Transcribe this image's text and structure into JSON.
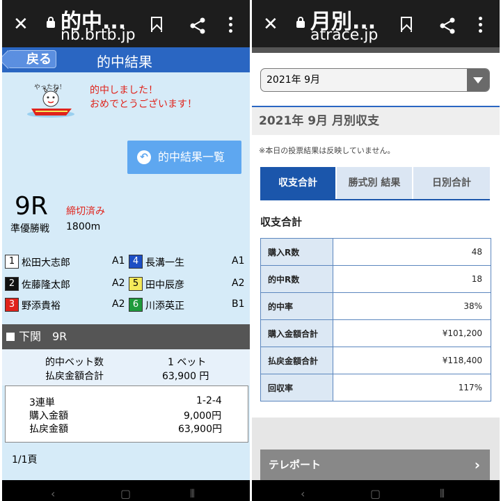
{
  "left": {
    "browser": {
      "title": "的中...",
      "url": "nb.brtb.jp"
    },
    "header": {
      "back_label": "戻る",
      "title": "的中結果"
    },
    "mascot_caption": "やったね！",
    "message": {
      "line1": "的中しました！",
      "line2": "おめでとうございます！"
    },
    "results_list_button": "的中結果一覧",
    "race": {
      "number": "9R",
      "status": "締切済み",
      "type": "準優勝戦",
      "distance": "1800m"
    },
    "racers": [
      {
        "num": "1",
        "name": "松田大志郎",
        "cls": "A1",
        "bg": "#ffffff",
        "fg": "#000000"
      },
      {
        "num": "2",
        "name": "佐藤隆太郎",
        "cls": "A2",
        "bg": "#111111",
        "fg": "#ffffff"
      },
      {
        "num": "3",
        "name": "野添貴裕",
        "cls": "A2",
        "bg": "#e0231b",
        "fg": "#ffffff"
      },
      {
        "num": "4",
        "name": "長溝一生",
        "cls": "A1",
        "bg": "#1d4fc4",
        "fg": "#ffffff"
      },
      {
        "num": "5",
        "name": "田中辰彦",
        "cls": "A2",
        "bg": "#f4ea5a",
        "fg": "#000000"
      },
      {
        "num": "6",
        "name": "川添英正",
        "cls": "B1",
        "bg": "#1f9a3c",
        "fg": "#ffffff"
      }
    ],
    "venue": {
      "name": "下関",
      "race": "9R"
    },
    "summary": {
      "bets_label": "的中ベット数",
      "bets_value": "1 ベット",
      "payout_label": "払戻金額合計",
      "payout_value": "63,900 円"
    },
    "detail": {
      "bet_type": "3連単",
      "combination": "1-2-4",
      "purchase_label": "購入金額",
      "purchase_value": "9,000円",
      "payout_label": "払戻金額",
      "payout_value": "63,900円"
    },
    "pages": "1/1頁"
  },
  "right": {
    "browser": {
      "title": "月別...",
      "url": "atrace.jp"
    },
    "month_select": "2021年 9月",
    "month_title": "2021年 9月 月別収支",
    "note": "※本日の投票結果は反映していません。",
    "tabs": [
      "収支合計",
      "勝式別 結果",
      "日別合計"
    ],
    "section_title": "収支合計",
    "table": [
      {
        "label": "購入R数",
        "value": "48"
      },
      {
        "label": "的中R数",
        "value": "18"
      },
      {
        "label": "的中率",
        "value": "38%"
      },
      {
        "label": "購入金額合計",
        "value": "¥101,200"
      },
      {
        "label": "払戻金額合計",
        "value": "¥118,400"
      },
      {
        "label": "回収率",
        "value": "117%"
      }
    ],
    "teleport": "テレポート"
  }
}
